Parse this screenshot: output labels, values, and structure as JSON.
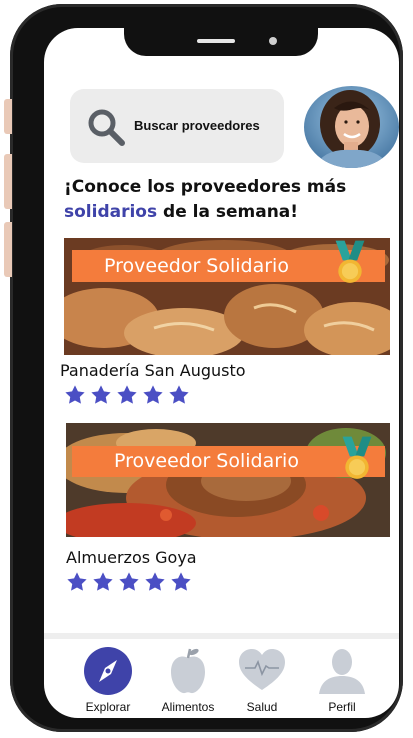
{
  "search": {
    "label": "Buscar proveedores"
  },
  "headline": {
    "line1": "¡Conoce los proveedores más",
    "accent_word": "solidarios",
    "line2_rest": " de la semana!"
  },
  "cards": [
    {
      "badge": "Proveedor Solidario",
      "name": "Panadería San Augusto",
      "rating": 5
    },
    {
      "badge": "Proveedor Solidario",
      "name": "Almuerzos Goya",
      "rating": 5
    }
  ],
  "nav": {
    "items": [
      {
        "label": "Explorar",
        "icon": "compass-icon"
      },
      {
        "label": "Alimentos",
        "icon": "apple-icon"
      },
      {
        "label": "Salud",
        "icon": "heart-pulse-icon"
      },
      {
        "label": "Perfil",
        "icon": "person-icon"
      }
    ]
  },
  "colors": {
    "accent": "#3f43a9",
    "star": "#4b4fc4",
    "badge": "#f47c3c",
    "nav_active": "#3f43a9",
    "nav_inactive": "#c9ced6"
  }
}
